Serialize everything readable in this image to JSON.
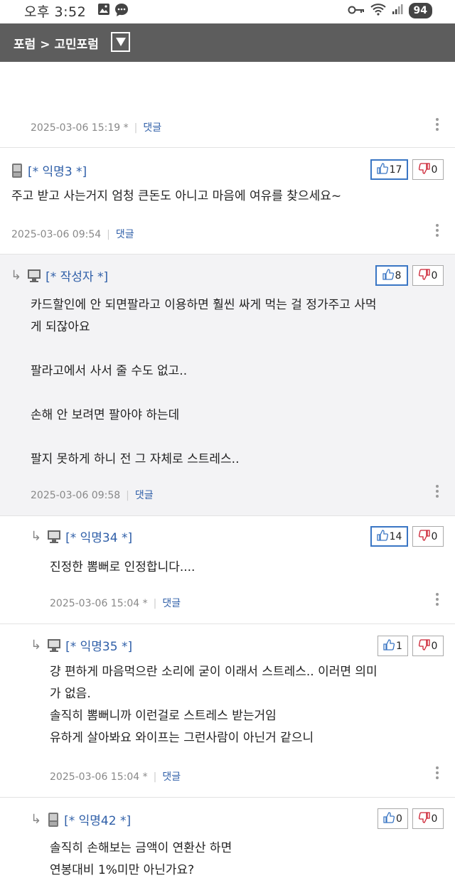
{
  "status": {
    "time": "오후 3:52",
    "battery": "94"
  },
  "nav": {
    "breadcrumb": "포럼 > 고민포럼"
  },
  "reply_label": "댓글",
  "comments": [
    {
      "date": "2025-03-06 15:19 *"
    },
    {
      "author": "[* 익명3 *]",
      "likes": "17",
      "dislikes": "0",
      "text": "주고 받고 사는거지 엄청 큰돈도 아니고 마음에 여유를 찾으세요~",
      "date": "2025-03-06 09:54"
    },
    {
      "author": "[* 작성자 *]",
      "likes": "8",
      "dislikes": "0",
      "text": "카드할인에 안 되면팔라고 이용하면 훨씬 싸게 먹는 걸 정가주고 사먹\n게 되잖아요\n\n팔라고에서 사서 줄 수도 없고..\n\n손해 안 보려면 팔아야 하는데\n\n팔지 못하게 하니 전 그 자체로 스트레스..",
      "date": "2025-03-06 09:58"
    },
    {
      "author": "[* 익명34 *]",
      "likes": "14",
      "dislikes": "0",
      "text": "진정한 뽐뻐로 인정합니다....",
      "date": "2025-03-06 15:04 *"
    },
    {
      "author": "[* 익명35 *]",
      "likes": "1",
      "dislikes": "0",
      "text": "걍 편하게 마음먹으란 소리에 굳이 이래서 스트레스.. 이러면 의미\n가 없음.\n솔직히 뽐뻐니까 이런걸로 스트레스 받는거임\n유하게 살아봐요 와이프는 그런사람이 아닌거 같으니",
      "date": "2025-03-06 15:04 *"
    },
    {
      "author": "[* 익명42 *]",
      "likes": "0",
      "dislikes": "0",
      "text": "솔직히 손해보는 금액이 연환산 하면\n연봉대비 1%미만 아닌가요?"
    }
  ]
}
